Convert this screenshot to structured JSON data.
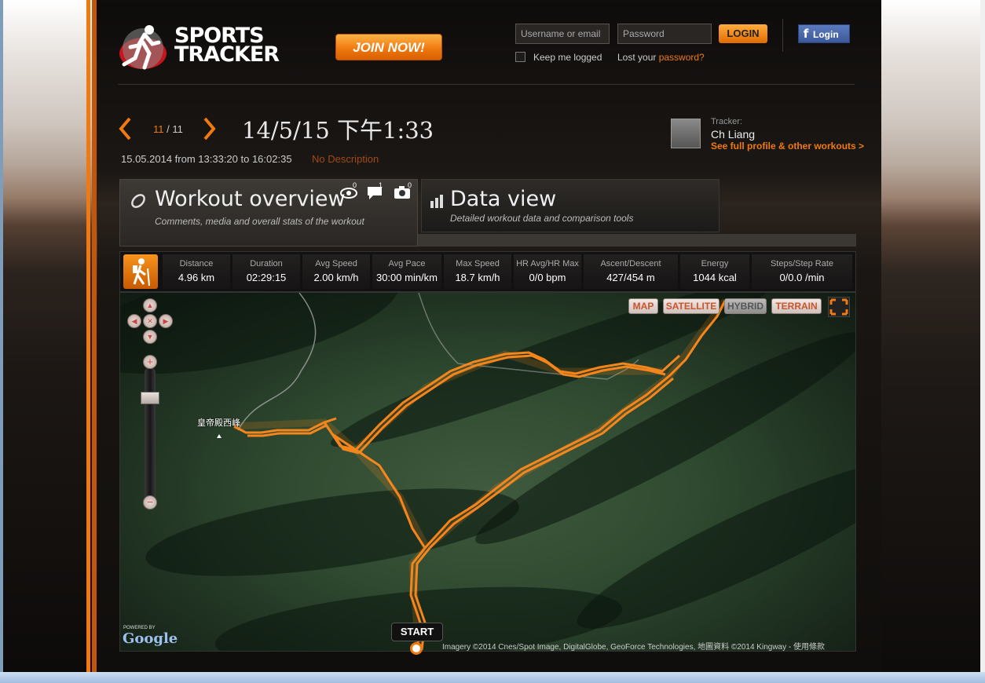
{
  "header": {
    "logo_line1": "SPORTS",
    "logo_line2": "TRACKER",
    "join_label": "JOIN NOW!",
    "username_placeholder": "Username or email",
    "password_placeholder": "Password",
    "login_label": "LOGIN",
    "keep_logged_label": "Keep me logged",
    "lost_prefix": "Lost your",
    "lost_link": "password?",
    "fb_icon_glyph": "f",
    "fb_label": "Login"
  },
  "workout": {
    "current": "11",
    "total": "/ 11",
    "title": "14/5/15 下午1:33",
    "date_range": "15.05.2014 from 13:33:20 to 16:02:35",
    "description": "No Description"
  },
  "tracker": {
    "label": "Tracker:",
    "name": "Ch Liang",
    "profile_link": "See full profile & other workouts >"
  },
  "tabs": [
    {
      "title": "Workout overview",
      "subtitle": "Comments, media and overall stats of the workout"
    },
    {
      "title": "Data view",
      "subtitle": "Detailed workout data and comparison tools"
    }
  ],
  "counters": {
    "views": "0",
    "comments": "1",
    "photos": "0"
  },
  "stats": [
    {
      "label": "Distance",
      "value": "4.96 km"
    },
    {
      "label": "Duration",
      "value": "02:29:15"
    },
    {
      "label": "Avg Speed",
      "value": "2.00 km/h"
    },
    {
      "label": "Avg Pace",
      "value": "30:00 min/km"
    },
    {
      "label": "Max Speed",
      "value": "18.7 km/h"
    },
    {
      "label": "HR Avg/HR Max",
      "value": "0/0 bpm"
    },
    {
      "label": "Ascent/Descent",
      "value": "427/454 m"
    },
    {
      "label": "Energy",
      "value": "1044 kcal"
    },
    {
      "label": "Steps/Step Rate",
      "value": "0/0.0 /min"
    }
  ],
  "map": {
    "types": [
      "MAP",
      "SATELLITE",
      "HYBRID",
      "TERRAIN"
    ],
    "selected_type": "HYBRID",
    "peak_label": "皇帝殿西峰",
    "start_label": "START",
    "powered_by": "POWERED BY",
    "google": "Google",
    "attribution": "Imagery ©2014 Cnes/Spot Image, DigitalGlobe, GeoForce Technologies, 地圖資料 ©2014 Kingway - 使用條款"
  },
  "colors": {
    "accent": "#f07a10",
    "route": "#ff8a1c"
  }
}
